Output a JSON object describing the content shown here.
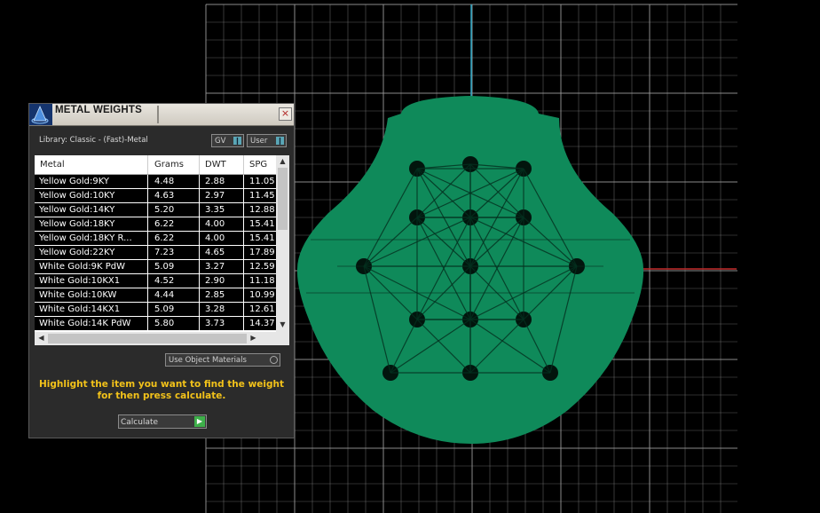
{
  "viewport": {
    "grid_color": "#9a9a9a",
    "axis_vertical_color": "#2aa6c4",
    "axis_horizontal_color": "#c22a2a",
    "model_color": "#0f8a5a"
  },
  "dialog": {
    "title": "METAL WEIGHTS",
    "close_label": "×",
    "library_label": "Library: Classic - (Fast)-Metal",
    "gv_label": "GV",
    "user_label": "User",
    "table": {
      "columns": [
        "Metal",
        "Grams",
        "DWT",
        "SPG"
      ],
      "rows": [
        [
          "Yellow Gold:9KY",
          "4.48",
          "2.88",
          "11.05"
        ],
        [
          "Yellow Gold:10KY",
          "4.63",
          "2.97",
          "11.45"
        ],
        [
          "Yellow Gold:14KY",
          "5.20",
          "3.35",
          "12.88"
        ],
        [
          "Yellow Gold:18KY",
          "6.22",
          "4.00",
          "15.41"
        ],
        [
          "Yellow Gold:18KY R...",
          "6.22",
          "4.00",
          "15.41"
        ],
        [
          "Yellow Gold:22KY",
          "7.23",
          "4.65",
          "17.89"
        ],
        [
          "White Gold:9K PdW",
          "5.09",
          "3.27",
          "12.59"
        ],
        [
          "White Gold:10KX1",
          "4.52",
          "2.90",
          "11.18"
        ],
        [
          "White Gold:10KW",
          "4.44",
          "2.85",
          "10.99"
        ],
        [
          "White Gold:14KX1",
          "5.09",
          "3.28",
          "12.61"
        ],
        [
          "White Gold:14K PdW",
          "5.80",
          "3.73",
          "14.37"
        ]
      ]
    },
    "use_object_materials_label": "Use Object Materials",
    "instruction_line1": "Highlight the item you want to find the weight",
    "instruction_line2": "for then press calculate.",
    "calculate_label": "Calculate",
    "accent_color": "#f2c21a"
  }
}
